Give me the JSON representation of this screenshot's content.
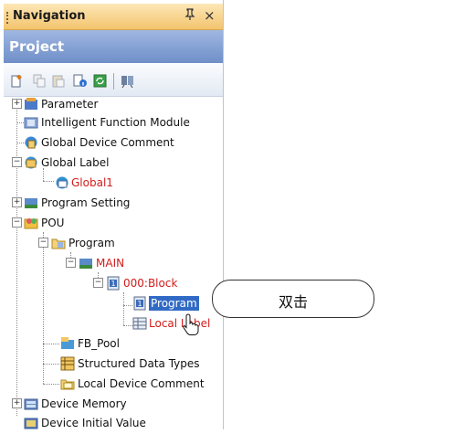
{
  "panel": {
    "title": "Navigation",
    "pin_glyph": "ᵖ",
    "close_glyph": "×",
    "header": "Project"
  },
  "toolbar": {
    "buttons": [
      "new-data-icon",
      "copy-icon",
      "paste-icon",
      "property-icon",
      "refresh-icon",
      "find-icon"
    ]
  },
  "tree": {
    "parameter": "Parameter",
    "intelligent_module": "Intelligent Function Module",
    "global_device_comment": "Global Device Comment",
    "global_label": "Global Label",
    "global1": "Global1",
    "program_setting": "Program Setting",
    "pou": "POU",
    "program_folder": "Program",
    "main": "MAIN",
    "block": "000:Block",
    "program_item": "Program",
    "local_label": "Local Label",
    "fb_pool": "FB_Pool",
    "structured_data_types": "Structured Data Types",
    "local_device_comment": "Local Device Comment",
    "device_memory": "Device Memory",
    "device_initial_value": "Device Initial Value"
  },
  "callout": {
    "text": "双击"
  },
  "colors": {
    "title_bar": "#f3c46e",
    "project_bar": "#6f8fc8",
    "selection": "#316ac5",
    "red_label": "#d41c1c"
  }
}
